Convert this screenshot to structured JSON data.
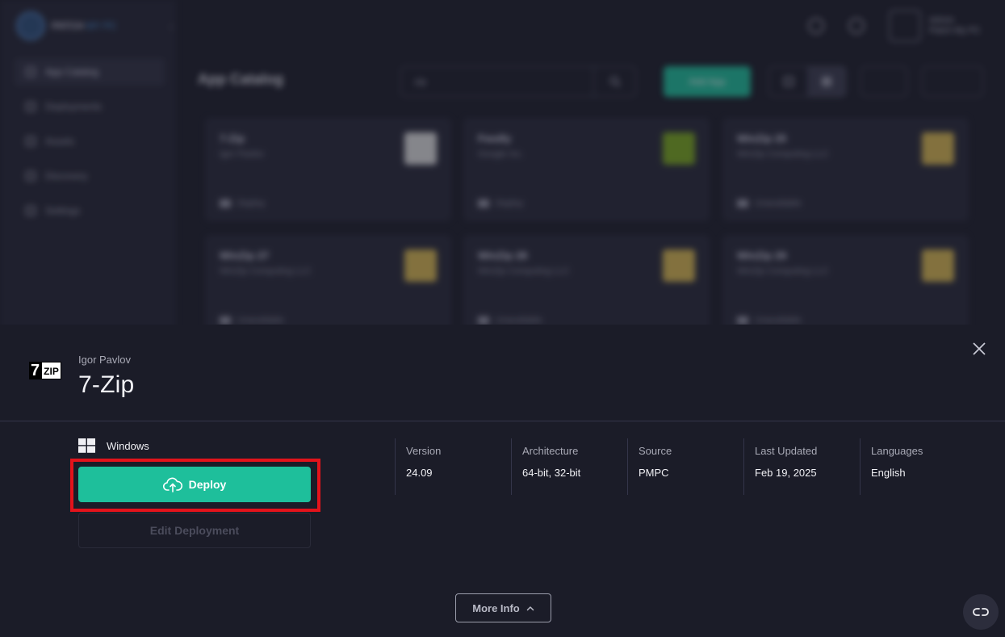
{
  "background": {
    "brand": {
      "name": "PATCH",
      "accent": "MY PC"
    },
    "nav": [
      {
        "label": "App Catalog",
        "active": true
      },
      {
        "label": "Deployments"
      },
      {
        "label": "Assets"
      },
      {
        "label": "Discovery"
      },
      {
        "label": "Settings"
      }
    ],
    "page_title": "App Catalog",
    "search_value": "zip",
    "add_app_label": "Add App",
    "user": {
      "name": "Admin",
      "role": "Patch My PC"
    },
    "cards": [
      {
        "title": "7-Zip",
        "vendor": "Igor Pavlov",
        "status": "Deploy"
      },
      {
        "title": "Feedly",
        "vendor": "Google Inc.",
        "status": "Deploy"
      },
      {
        "title": "WinZip 25",
        "vendor": "WinZip Computing LLC",
        "status": "Unavailable"
      },
      {
        "title": "WinZip 27",
        "vendor": "WinZip Computing LLC",
        "status": "Unavailable"
      },
      {
        "title": "WinZip 28",
        "vendor": "WinZip Computing LLC",
        "status": "Unavailable"
      },
      {
        "title": "WinZip 29",
        "vendor": "WinZip Computing LLC",
        "status": "Unavailable"
      }
    ]
  },
  "panel": {
    "vendor": "Igor Pavlov",
    "app_name": "7-Zip",
    "logo": {
      "left": "7",
      "right": "ZIP"
    },
    "platform": "Windows",
    "deploy_label": "Deploy",
    "edit_label": "Edit Deployment",
    "more_info_label": "More Info",
    "meta": [
      {
        "label": "Version",
        "value": "24.09"
      },
      {
        "label": "Architecture",
        "value": "64-bit, 32-bit"
      },
      {
        "label": "Source",
        "value": "PMPC"
      },
      {
        "label": "Last Updated",
        "value": "Feb 19, 2025"
      },
      {
        "label": "Languages",
        "value": "English"
      }
    ]
  },
  "colors": {
    "accent": "#1ebf9b",
    "panel_bg": "#1b1c28",
    "highlight": "#e3131b"
  }
}
